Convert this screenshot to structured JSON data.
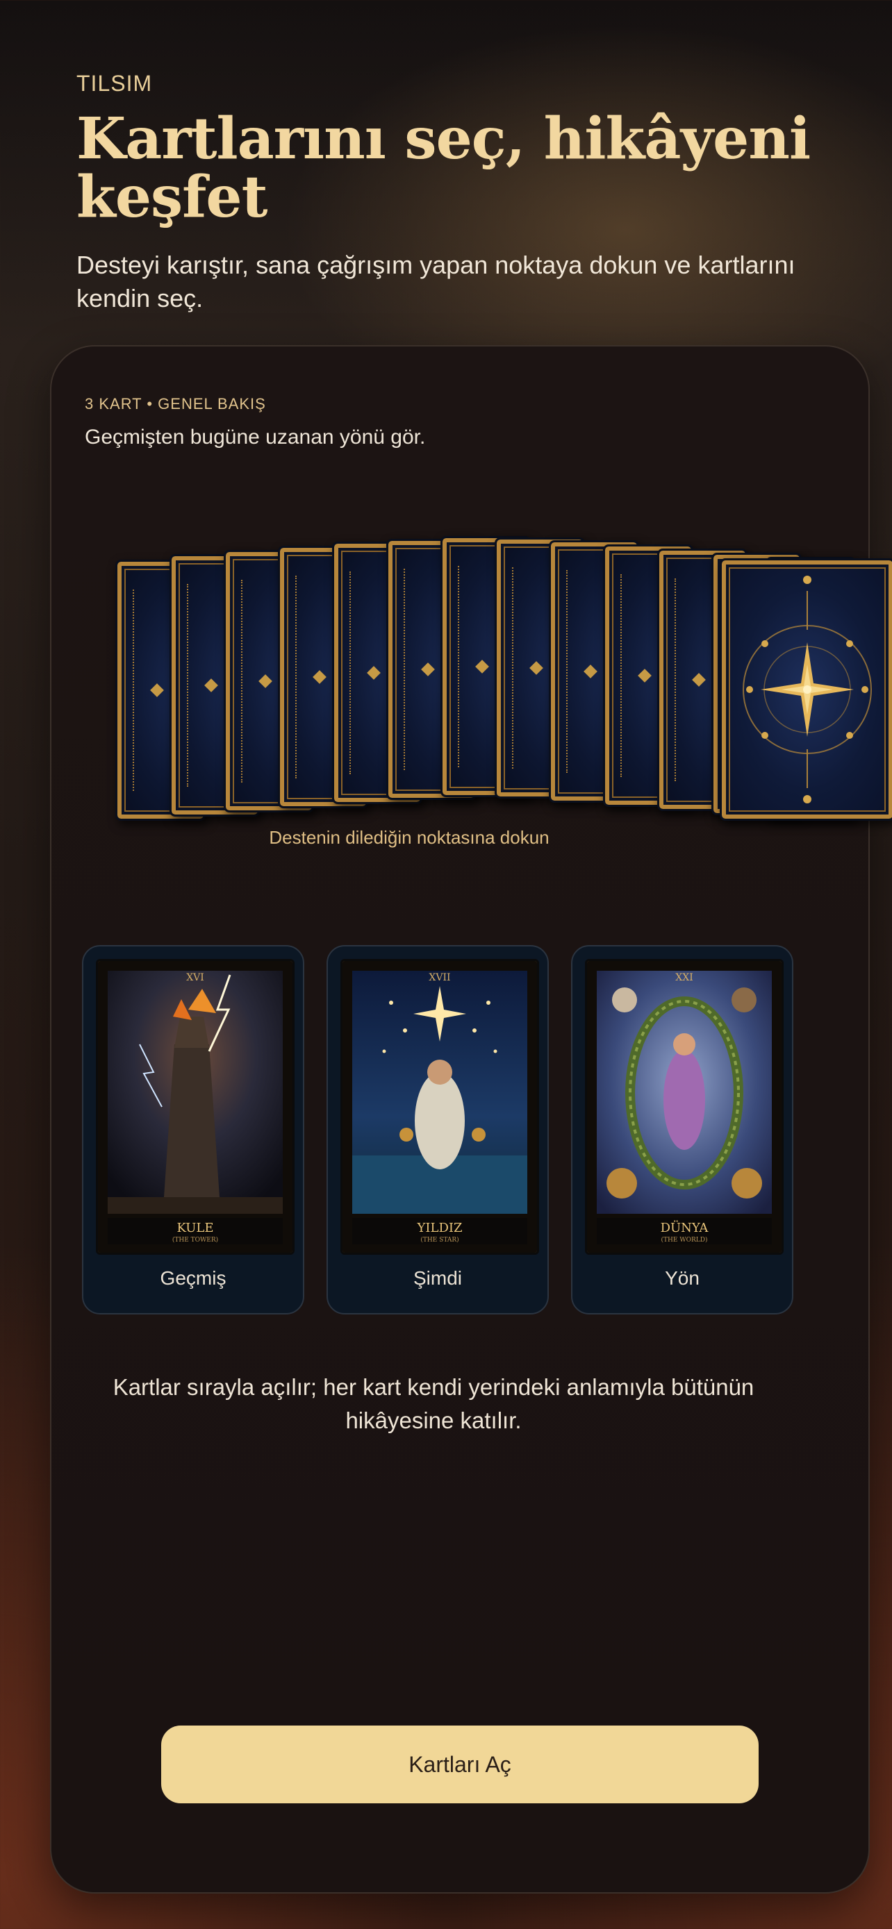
{
  "header": {
    "eyebrow": "TILSIM",
    "title": "Kartlarını seç, hikâyeni keşfet",
    "lead": "Desteyi karıştır, sana çağrışım yapan noktaya dokun ve kartlarını kendin seç."
  },
  "panel": {
    "spread_label": "3 KART • GENEL BAKIŞ",
    "spread_desc": "Geçmişten bugüne uzanan yönü gör.",
    "deck_hint": "Destenin dilediğin noktasına dokun",
    "cards": [
      {
        "numeral": "XVI",
        "name": "KULE",
        "subtitle": "(THE TOWER)",
        "position_label": "Geçmiş"
      },
      {
        "numeral": "XVII",
        "name": "YILDIZ",
        "subtitle": "(THE STAR)",
        "position_label": "Şimdi"
      },
      {
        "numeral": "XXI",
        "name": "DÜNYA",
        "subtitle": "(THE WORLD)",
        "position_label": "Yön"
      }
    ],
    "note": "Kartlar sırayla açılır; her kart kendi yerindeki anlamıyla bütünün hikâyesine katılır.",
    "cta_label": "Kartları Aç"
  },
  "colors": {
    "accent": "#f1d797",
    "gold": "#b8873b",
    "navy": "#0f1a38"
  }
}
